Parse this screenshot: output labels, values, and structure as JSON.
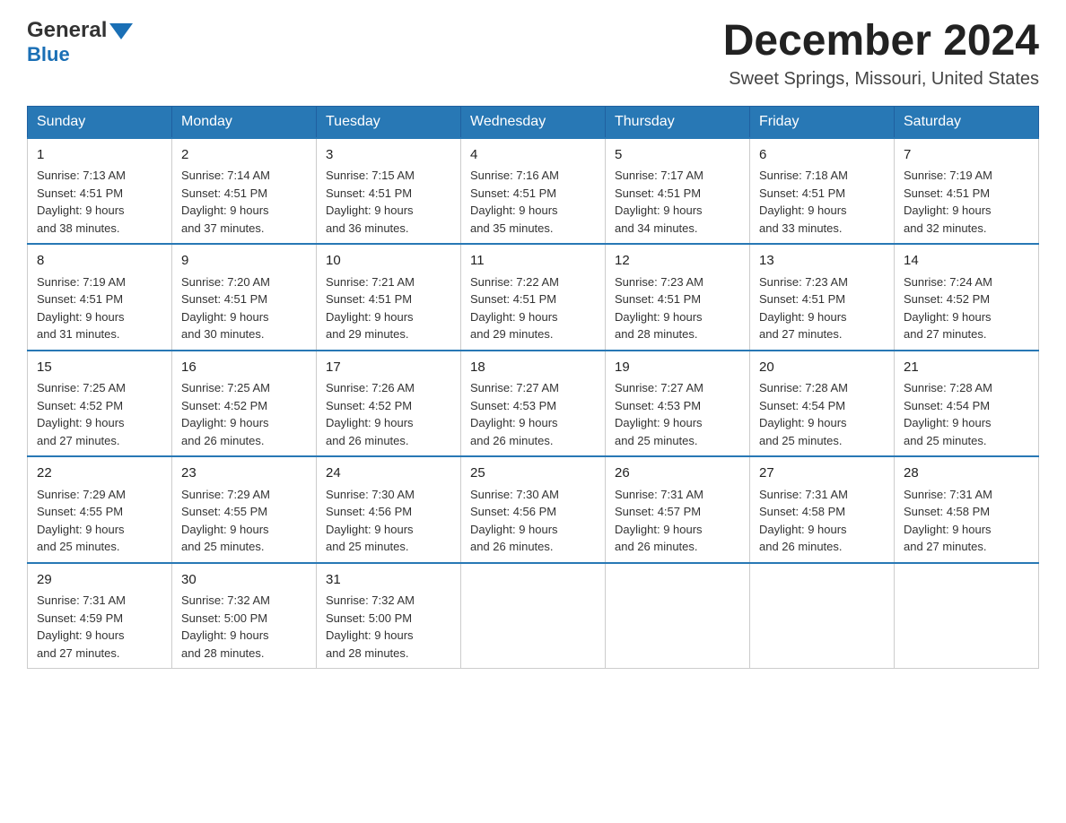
{
  "header": {
    "logo_general": "General",
    "logo_blue": "Blue",
    "page_title": "December 2024",
    "subtitle": "Sweet Springs, Missouri, United States"
  },
  "days_of_week": [
    "Sunday",
    "Monday",
    "Tuesday",
    "Wednesday",
    "Thursday",
    "Friday",
    "Saturday"
  ],
  "weeks": [
    [
      {
        "day": "1",
        "sunrise": "7:13 AM",
        "sunset": "4:51 PM",
        "daylight": "9 hours and 38 minutes."
      },
      {
        "day": "2",
        "sunrise": "7:14 AM",
        "sunset": "4:51 PM",
        "daylight": "9 hours and 37 minutes."
      },
      {
        "day": "3",
        "sunrise": "7:15 AM",
        "sunset": "4:51 PM",
        "daylight": "9 hours and 36 minutes."
      },
      {
        "day": "4",
        "sunrise": "7:16 AM",
        "sunset": "4:51 PM",
        "daylight": "9 hours and 35 minutes."
      },
      {
        "day": "5",
        "sunrise": "7:17 AM",
        "sunset": "4:51 PM",
        "daylight": "9 hours and 34 minutes."
      },
      {
        "day": "6",
        "sunrise": "7:18 AM",
        "sunset": "4:51 PM",
        "daylight": "9 hours and 33 minutes."
      },
      {
        "day": "7",
        "sunrise": "7:19 AM",
        "sunset": "4:51 PM",
        "daylight": "9 hours and 32 minutes."
      }
    ],
    [
      {
        "day": "8",
        "sunrise": "7:19 AM",
        "sunset": "4:51 PM",
        "daylight": "9 hours and 31 minutes."
      },
      {
        "day": "9",
        "sunrise": "7:20 AM",
        "sunset": "4:51 PM",
        "daylight": "9 hours and 30 minutes."
      },
      {
        "day": "10",
        "sunrise": "7:21 AM",
        "sunset": "4:51 PM",
        "daylight": "9 hours and 29 minutes."
      },
      {
        "day": "11",
        "sunrise": "7:22 AM",
        "sunset": "4:51 PM",
        "daylight": "9 hours and 29 minutes."
      },
      {
        "day": "12",
        "sunrise": "7:23 AM",
        "sunset": "4:51 PM",
        "daylight": "9 hours and 28 minutes."
      },
      {
        "day": "13",
        "sunrise": "7:23 AM",
        "sunset": "4:51 PM",
        "daylight": "9 hours and 27 minutes."
      },
      {
        "day": "14",
        "sunrise": "7:24 AM",
        "sunset": "4:52 PM",
        "daylight": "9 hours and 27 minutes."
      }
    ],
    [
      {
        "day": "15",
        "sunrise": "7:25 AM",
        "sunset": "4:52 PM",
        "daylight": "9 hours and 27 minutes."
      },
      {
        "day": "16",
        "sunrise": "7:25 AM",
        "sunset": "4:52 PM",
        "daylight": "9 hours and 26 minutes."
      },
      {
        "day": "17",
        "sunrise": "7:26 AM",
        "sunset": "4:52 PM",
        "daylight": "9 hours and 26 minutes."
      },
      {
        "day": "18",
        "sunrise": "7:27 AM",
        "sunset": "4:53 PM",
        "daylight": "9 hours and 26 minutes."
      },
      {
        "day": "19",
        "sunrise": "7:27 AM",
        "sunset": "4:53 PM",
        "daylight": "9 hours and 25 minutes."
      },
      {
        "day": "20",
        "sunrise": "7:28 AM",
        "sunset": "4:54 PM",
        "daylight": "9 hours and 25 minutes."
      },
      {
        "day": "21",
        "sunrise": "7:28 AM",
        "sunset": "4:54 PM",
        "daylight": "9 hours and 25 minutes."
      }
    ],
    [
      {
        "day": "22",
        "sunrise": "7:29 AM",
        "sunset": "4:55 PM",
        "daylight": "9 hours and 25 minutes."
      },
      {
        "day": "23",
        "sunrise": "7:29 AM",
        "sunset": "4:55 PM",
        "daylight": "9 hours and 25 minutes."
      },
      {
        "day": "24",
        "sunrise": "7:30 AM",
        "sunset": "4:56 PM",
        "daylight": "9 hours and 25 minutes."
      },
      {
        "day": "25",
        "sunrise": "7:30 AM",
        "sunset": "4:56 PM",
        "daylight": "9 hours and 26 minutes."
      },
      {
        "day": "26",
        "sunrise": "7:31 AM",
        "sunset": "4:57 PM",
        "daylight": "9 hours and 26 minutes."
      },
      {
        "day": "27",
        "sunrise": "7:31 AM",
        "sunset": "4:58 PM",
        "daylight": "9 hours and 26 minutes."
      },
      {
        "day": "28",
        "sunrise": "7:31 AM",
        "sunset": "4:58 PM",
        "daylight": "9 hours and 27 minutes."
      }
    ],
    [
      {
        "day": "29",
        "sunrise": "7:31 AM",
        "sunset": "4:59 PM",
        "daylight": "9 hours and 27 minutes."
      },
      {
        "day": "30",
        "sunrise": "7:32 AM",
        "sunset": "5:00 PM",
        "daylight": "9 hours and 28 minutes."
      },
      {
        "day": "31",
        "sunrise": "7:32 AM",
        "sunset": "5:00 PM",
        "daylight": "9 hours and 28 minutes."
      },
      null,
      null,
      null,
      null
    ]
  ],
  "labels": {
    "sunrise": "Sunrise:",
    "sunset": "Sunset:",
    "daylight": "Daylight:"
  }
}
